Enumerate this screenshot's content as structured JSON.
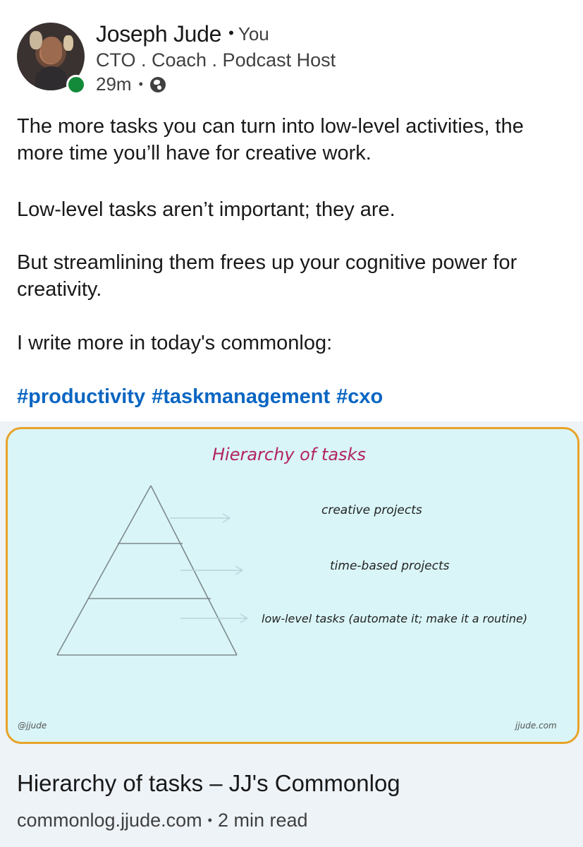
{
  "author": {
    "name": "Joseph Jude",
    "relation": "You",
    "headline": "CTO . Coach . Podcast Host",
    "time": "29m",
    "visibility_icon": "globe-icon",
    "online_status_color": "#138a3a"
  },
  "post": {
    "paragraphs": [
      "The more tasks you can turn into low-level activities, the more time you’ll have for creative work.",
      "Low-level tasks aren’t important; they are.",
      "But streamlining them frees up your cognitive power for creativity.",
      "I write more in today's commonlog:"
    ],
    "hashtags": [
      "#productivity",
      "#taskmanagement",
      "#cxo"
    ],
    "hashtag_color": "#0a66c2"
  },
  "link_preview": {
    "image": {
      "title": "Hierarchy of tasks",
      "levels": [
        "creative projects",
        "time-based projects",
        "low-level tasks (automate it; make it a routine)"
      ],
      "handle": "@jjude",
      "site": "jjude.com",
      "border_color": "#e8a328",
      "background_color": "#d9f5f7",
      "title_color": "#b3245e"
    },
    "title": "Hierarchy of tasks – JJ's Commonlog",
    "domain": "commonlog.jjude.com",
    "read_time": "2 min read"
  }
}
